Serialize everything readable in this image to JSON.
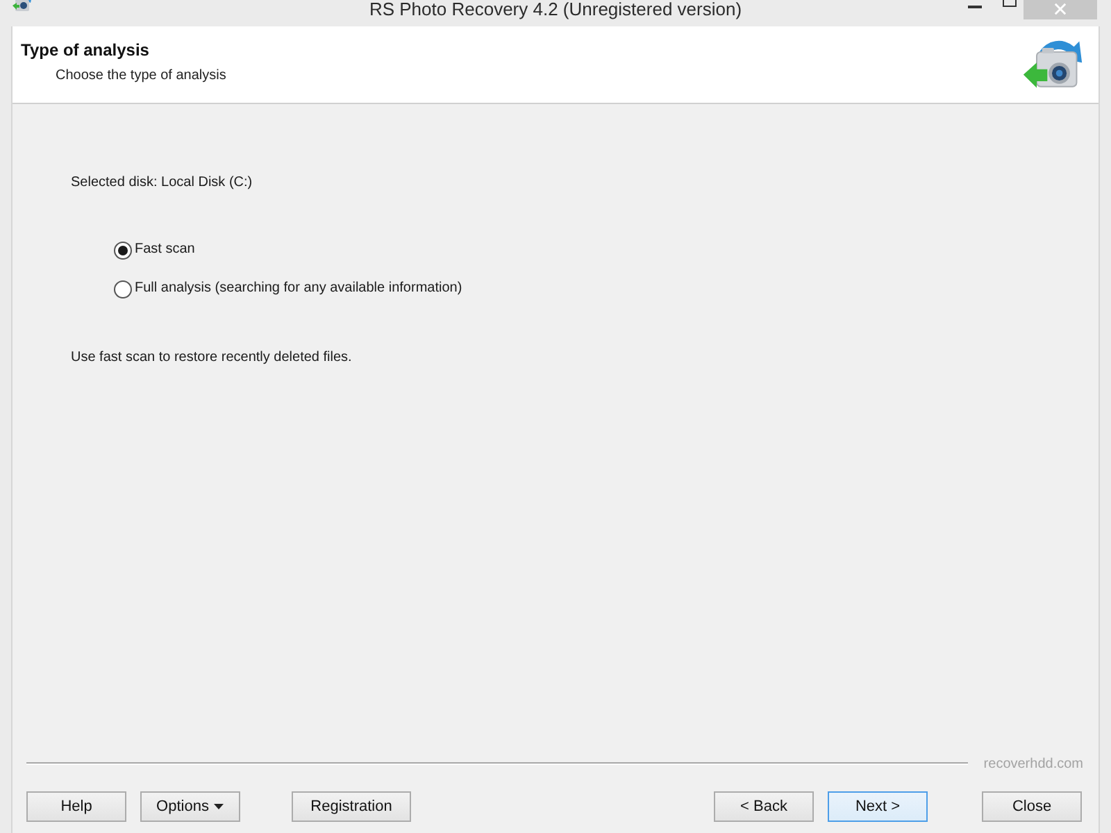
{
  "window": {
    "title": "RS Photo Recovery 4.2 (Unregistered version)"
  },
  "header": {
    "title": "Type of analysis",
    "subtitle": "Choose the type of analysis"
  },
  "disk_label": "Selected disk: Local Disk (C:)",
  "scan_options": [
    {
      "label": "Fast scan",
      "selected": true
    },
    {
      "label": "Full analysis (searching for any available information)",
      "selected": false
    }
  ],
  "hint": "Use fast scan to restore recently deleted files.",
  "website": "recoverhdd.com",
  "buttons": [
    {
      "label": "Help",
      "kind": "plain"
    },
    {
      "label": "Options",
      "kind": "dropdown"
    },
    {
      "label": "Registration",
      "kind": "plain"
    },
    {
      "label": "< Back",
      "kind": "plain"
    },
    {
      "label": "Next >",
      "kind": "default"
    },
    {
      "label": "Close",
      "kind": "plain"
    }
  ]
}
